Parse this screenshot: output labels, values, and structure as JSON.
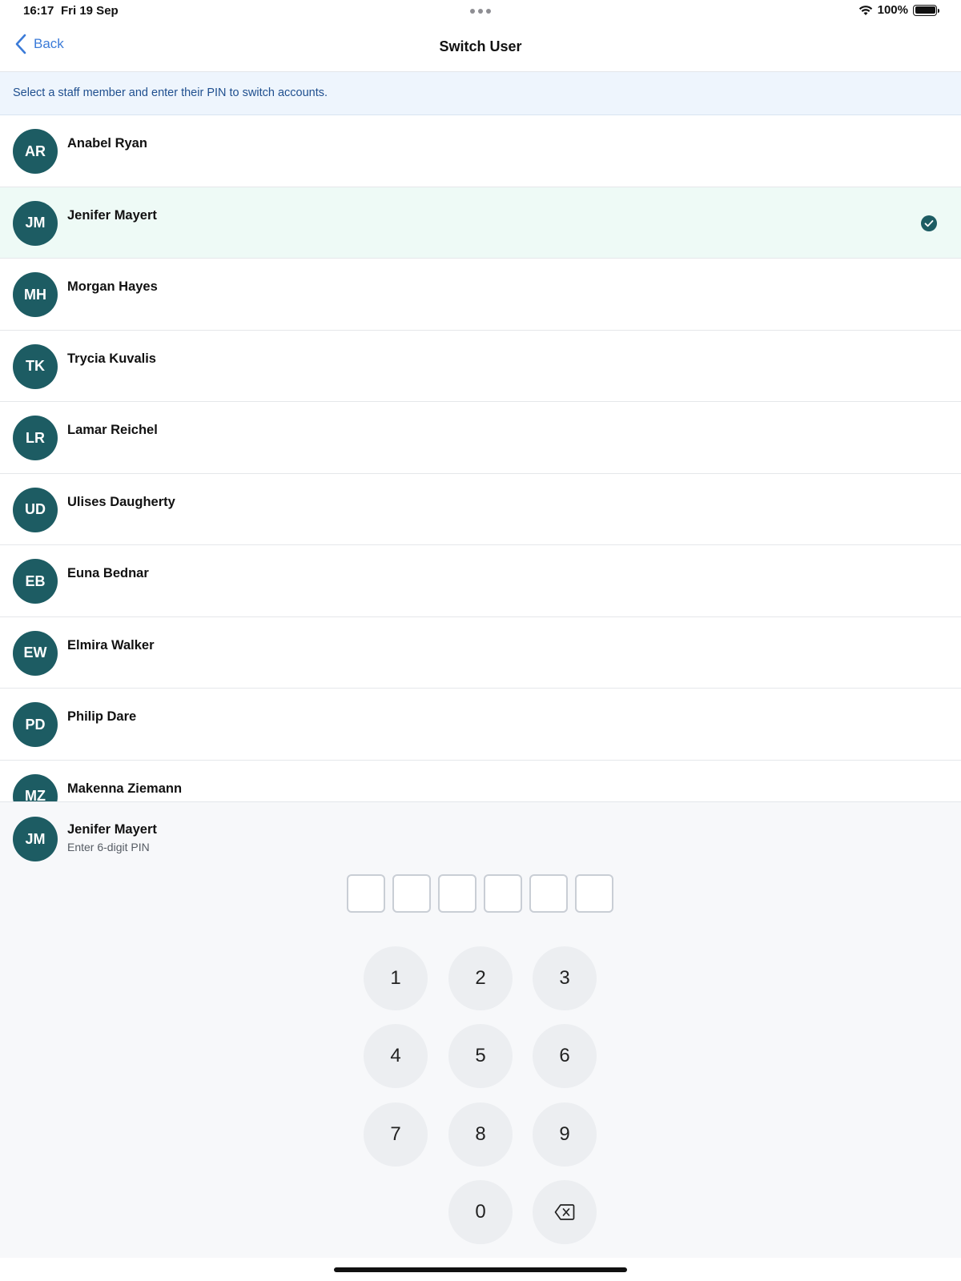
{
  "status": {
    "time": "16:17",
    "date": "Fri 19 Sep",
    "battery": "100%"
  },
  "nav": {
    "back_label": "Back",
    "title": "Switch User"
  },
  "banner": {
    "text": "Select a staff member and enter their PIN to switch accounts."
  },
  "users": [
    {
      "initials": "AR",
      "name": "Anabel Ryan",
      "selected": false
    },
    {
      "initials": "JM",
      "name": "Jenifer Mayert",
      "selected": true
    },
    {
      "initials": "MH",
      "name": "Morgan Hayes",
      "selected": false
    },
    {
      "initials": "TK",
      "name": "Trycia Kuvalis",
      "selected": false
    },
    {
      "initials": "LR",
      "name": "Lamar Reichel",
      "selected": false
    },
    {
      "initials": "UD",
      "name": "Ulises Daugherty",
      "selected": false
    },
    {
      "initials": "EB",
      "name": "Euna Bednar",
      "selected": false
    },
    {
      "initials": "EW",
      "name": "Elmira Walker",
      "selected": false
    },
    {
      "initials": "PD",
      "name": "Philip Dare",
      "selected": false
    },
    {
      "initials": "MZ",
      "name": "Makenna Ziemann",
      "selected": false
    }
  ],
  "pin_panel": {
    "initials": "JM",
    "name": "Jenifer Mayert",
    "prompt": "Enter 6-digit PIN",
    "digits_entered": 0,
    "digits_total": 6
  },
  "keypad": {
    "keys": [
      "1",
      "2",
      "3",
      "4",
      "5",
      "6",
      "7",
      "8",
      "9",
      "0"
    ],
    "delete_icon": "backspace-icon"
  },
  "colors": {
    "accent": "#3b7bd8",
    "avatar": "#1d5c63",
    "selected_row": "#eefaf6",
    "banner": "#eef5fd"
  }
}
